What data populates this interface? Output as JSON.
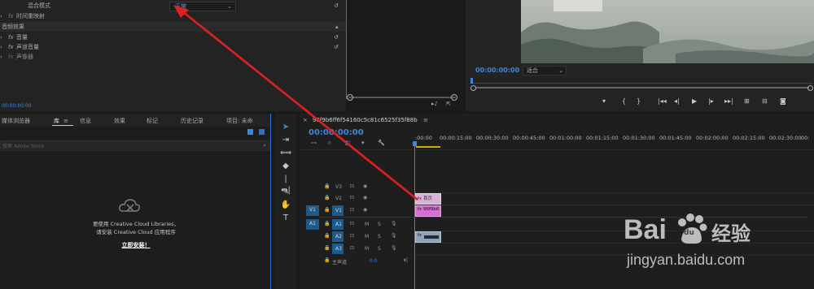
{
  "effect_controls": {
    "blend_mode_label": "混合模式",
    "blend_mode_value": "正常",
    "time_remap_label": "时间重映射",
    "audio_effects_label": "音频效果",
    "volume_label": "音量",
    "channel_volume_label": "声道音量",
    "panner_label": "声像器",
    "timecode": "00:00:00:00",
    "fx_label": "fx"
  },
  "program_monitor": {
    "timecode": "00:00:00:00",
    "fit_value": "适合"
  },
  "project_panel": {
    "tabs": [
      "媒体浏览器",
      "库",
      "信息",
      "效果",
      "标记",
      "历史记录",
      "项目: 未命"
    ],
    "search_placeholder": "搜索 Adobe Stock",
    "cc_message_line1": "要使用 Creative Cloud Libraries，",
    "cc_message_line2": "请安装 Creative Cloud 应用程序",
    "install_link": "立即安装！"
  },
  "timeline": {
    "sequence_name": "96f9b6ff6f54160c5c81c6525f35f88b",
    "timecode": "00:00:00:00",
    "ruler_ticks": [
      ":00:00",
      "00:00:15:00",
      "00:00:30:00",
      "00:00:45:00",
      "00:01:00:00",
      "00:01:15:00",
      "00:01:30:00",
      "00:01:45:00",
      "00:02:00:00",
      "00:02:15:00",
      "00:02:30:00",
      "00:"
    ],
    "video_tracks": [
      "V3",
      "V2",
      "V1"
    ],
    "audio_tracks": [
      "A1",
      "A2",
      "A3"
    ],
    "source_v": "V1",
    "source_a": "A1",
    "mute_label": "M",
    "solo_label": "S",
    "master_label": "主声道",
    "master_value": "0.0",
    "clips": {
      "v2_label": "fx 首页",
      "v1_label": "fx 96f9b6",
      "a2_label": "fx"
    }
  },
  "watermark": {
    "brand": "Bai",
    "paw": "du",
    "suffix": "经验",
    "url": "jingyan.baidu.com"
  }
}
